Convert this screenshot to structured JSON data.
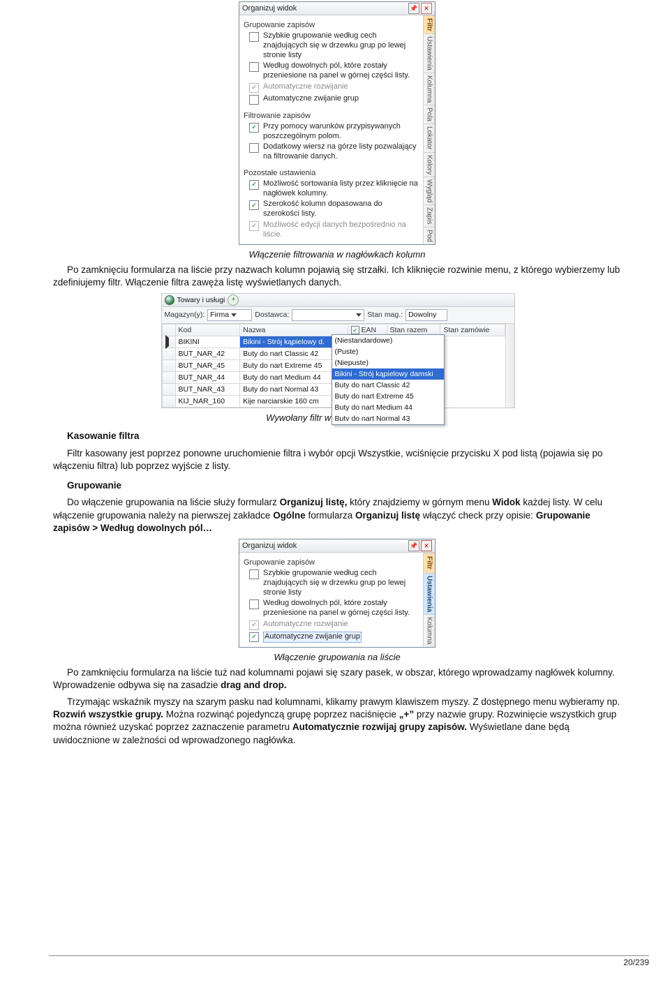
{
  "dialog1": {
    "title": "Organizuj widok",
    "tabs": [
      "Filtr",
      "Ustawienia",
      "Kolumna",
      "Pola",
      "Lokator",
      "Kolory",
      "Wygląd",
      "Zapis",
      "Pod"
    ],
    "section1": "Grupowanie zapisów",
    "section2": "Filtrowanie zapisów",
    "section3": "Pozostałe ustawienia",
    "opts": {
      "g1": "Szybkie grupowanie według cech znajdujących się w drzewku grup po lewej stronie listy",
      "g2": "Według dowolnych pól, które zostały przeniesione na panel w górnej części listy.",
      "g3": "Automatyczne rozwijanie",
      "g4": "Automatyczne zwijanie grup",
      "f1": "Przy pomocy warunków przypisywanych poszczególnym polom.",
      "f2": "Dodatkowy wiersz na górze listy pozwalający na filtrowanie danych.",
      "p1": "Możliwość sortowania listy przez kliknięcie na nagłówek kolumny.",
      "p2": "Szerokość kolumn dopasowana do szerokości listy.",
      "p3": "Możliwość edycji danych bezpośrednio na liście."
    }
  },
  "cap1": "Włączenie filtrowania w nagłówkach kolumn",
  "para1": "Po zamknięciu formularza na liście przy nazwach kolumn pojawią się strzałki. Ich kliknięcie rozwinie menu, z którego wybierzemy lub zdefiniujemy filtr. Włączenie filtra zawęża listę wyświetlanych danych.",
  "shot2": {
    "module": "Towary i usługi",
    "lbl_mag": "Magazyn(y):",
    "val_mag": "Firma",
    "lbl_dost": "Dostawca:",
    "lbl_stan": "Stan mag.:",
    "val_stan": "Dowolny",
    "cols": {
      "kod": "Kod",
      "nazwa": "Nazwa",
      "ean": "EAN",
      "stanr": "Stan razem",
      "stanz": "Stan zamówie"
    },
    "rows": [
      {
        "kod": "BIKINI",
        "nazwa": "Bikini - Strój kąpielowy d.",
        "sel": true
      },
      {
        "kod": "BUT_NAR_42",
        "nazwa": "Buty do nart Classic 42"
      },
      {
        "kod": "BUT_NAR_45",
        "nazwa": "Buty do nart Extreme 45"
      },
      {
        "kod": "BUT_NAR_44",
        "nazwa": "Buty do nart Medium 44"
      },
      {
        "kod": "BUT_NAR_43",
        "nazwa": "Buty do nart Normal 43"
      },
      {
        "kod": "KIJ_NAR_160",
        "nazwa": "Kije narciarskie 160 cm"
      }
    ],
    "dd": [
      "(Niestandardowe)",
      "(Puste)",
      "(Niepuste)",
      "Bikini - Strój kąpielowy damski",
      "Buty do nart Classic 42",
      "Buty do nart Extreme 45",
      "Buty do nart Medium 44",
      "Butv do nart Normal 43"
    ]
  },
  "cap2": "Wywołany filtr w nagłówku kolumny",
  "h_kasowanie": "Kasowanie filtra",
  "para2": "Filtr kasowany jest poprzez ponowne uruchomienie filtra i wybór opcji Wszystkie, wciśnięcie przycisku X pod listą (pojawia się po włączeniu filtra) lub poprzez wyjście z listy.",
  "h_grupowanie": "Grupowanie",
  "para3_pre": "Do włączenie grupowania na liście służy formularz ",
  "para3_b1": "Organizuj listę,",
  "para3_mid1": " który znajdziemy w górnym menu ",
  "para3_b2": "Widok",
  "para3_mid2": " każdej listy. W celu włączenie grupowania należy na pierwszej zakładce ",
  "para3_b3": "Ogólne",
  "para3_mid3": " formularza ",
  "para3_b4": "Organizuj listę",
  "para3_mid4": " włączyć check przy opisie: ",
  "para3_b5": "Grupowanie zapisów > Według dowolnych pól…",
  "dialog2": {
    "title": "Organizuj widok",
    "tabs": [
      "Filtr",
      "Ustawienia",
      "Kolumna"
    ],
    "section1": "Grupowanie zapisów",
    "opts": {
      "g1": "Szybkie grupowanie według cech znajdujących się w drzewku grup po lewej stronie listy",
      "g2": "Według dowolnych pól, które zostały przeniesione na panel w górnej części listy.",
      "g3": "Automatyczne rozwijanie",
      "g4": "Automatyczne zwijanie grup"
    }
  },
  "cap3": "Włączenie grupowania na liście",
  "para4_pre": "Po zamknięciu formularza na liście tuż nad kolumnami pojawi się szary pasek, w obszar, którego wprowadzamy nagłówek kolumny. Wprowadzenie odbywa się na zasadzie ",
  "para4_b1": "drag and drop.",
  "para5_pre": "Trzymając wskaźnik myszy na szarym pasku nad kolumnami, klikamy prawym klawiszem myszy. Z dostępnego menu wybieramy np. ",
  "para5_b1": "Rozwiń wszystkie grupy.",
  "para5_mid1": " Można rozwinąć pojedynczą grupę poprzez naciśnięcie ",
  "para5_b2": "„+”",
  "para5_mid2": " przy nazwie grupy. Rozwinięcie wszystkich grup można również uzyskać poprzez zaznaczenie parametru ",
  "para5_b3": "Automatycznie rozwijaj grupy zapisów.",
  "para5_end": " Wyświetlane dane będą uwidocznione w zależności od wprowadzonego nagłówka.",
  "pageno": "20/239"
}
